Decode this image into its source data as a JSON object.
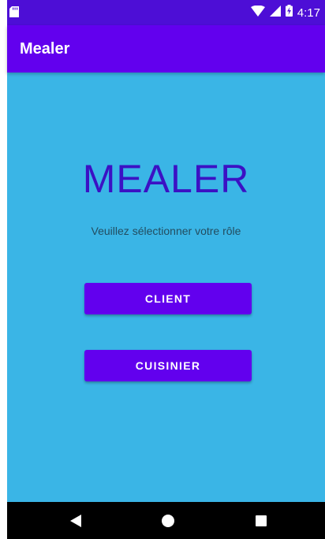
{
  "status_bar": {
    "time": "4:17",
    "icons": [
      "sd-card-icon",
      "wifi-icon",
      "signal-icon",
      "battery-charging-icon"
    ]
  },
  "app_bar": {
    "title": "Mealer"
  },
  "main": {
    "headline": "MEALER",
    "subtitle": "Veuillez sélectionner votre rôle",
    "buttons": {
      "client": "CLIENT",
      "cook": "CUISINIER"
    }
  },
  "nav_bar": {
    "icons": [
      "back-icon",
      "home-icon",
      "recents-icon"
    ]
  },
  "colors": {
    "status_bar": "#4d0ed6",
    "app_bar": "#6200ee",
    "background": "#3ab5e6",
    "headline": "#3b11c4",
    "button": "#6200ee",
    "nav_bar": "#000000"
  }
}
